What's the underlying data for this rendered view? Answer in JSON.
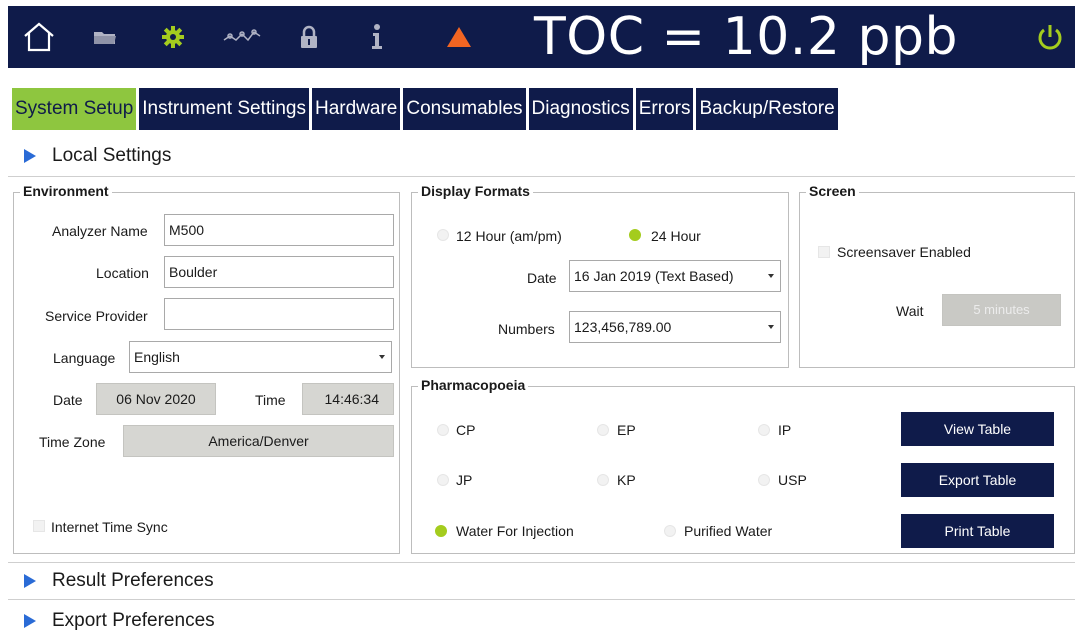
{
  "topbar": {
    "icons": [
      "home-icon",
      "folder-icon",
      "gear-icon",
      "graph-icon",
      "lock-icon",
      "info-icon",
      "warning-icon",
      "power-icon"
    ],
    "toc_reading": "TOC = 10.2 ppb",
    "colors": {
      "bar": "#0f1b4a",
      "gear": "#a4cc1e",
      "warning": "#f26522",
      "power": "#a4cc1e"
    }
  },
  "tabs": [
    {
      "label": "System Setup",
      "active": true
    },
    {
      "label": "Instrument Settings",
      "active": false
    },
    {
      "label": "Hardware",
      "active": false
    },
    {
      "label": "Consumables",
      "active": false
    },
    {
      "label": "Diagnostics",
      "active": false
    },
    {
      "label": "Errors",
      "active": false
    },
    {
      "label": "Backup/Restore",
      "active": false
    }
  ],
  "sections": {
    "local_settings": "Local Settings",
    "result_preferences": "Result Preferences",
    "export_preferences": "Export Preferences"
  },
  "environment": {
    "title": "Environment",
    "analyzer_name_label": "Analyzer Name",
    "analyzer_name_value": "M500",
    "location_label": "Location",
    "location_value": "Boulder",
    "service_provider_label": "Service Provider",
    "service_provider_value": "",
    "language_label": "Language",
    "language_value": "English",
    "date_label": "Date",
    "date_value": "06 Nov 2020",
    "time_label": "Time",
    "time_value": "14:46:34",
    "timezone_label": "Time Zone",
    "timezone_value": "America/Denver",
    "internet_sync_label": "Internet Time Sync",
    "internet_sync_checked": false
  },
  "display_formats": {
    "title": "Display Formats",
    "hour12_label": "12 Hour (am/pm)",
    "hour24_label": "24 Hour",
    "selected": "24 Hour",
    "date_label": "Date",
    "date_value": "16 Jan 2019 (Text Based)",
    "numbers_label": "Numbers",
    "numbers_value": "123,456,789.00"
  },
  "screen": {
    "title": "Screen",
    "screensaver_label": "Screensaver Enabled",
    "screensaver_checked": false,
    "wait_label": "Wait",
    "wait_value": "5 minutes"
  },
  "pharmacopoeia": {
    "title": "Pharmacopoeia",
    "options": [
      "CP",
      "EP",
      "IP",
      "JP",
      "KP",
      "USP",
      "Water For Injection",
      "Purified Water"
    ],
    "selected": "Water For Injection",
    "view_table": "View Table",
    "export_table": "Export Table",
    "print_table": "Print Table"
  }
}
